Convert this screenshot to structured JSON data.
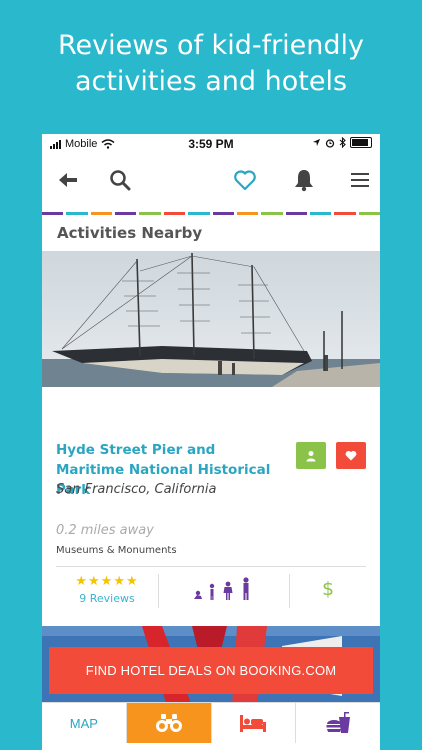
{
  "headline": {
    "line1": "Reviews of kid-friendly",
    "line2": "activities and hotels"
  },
  "status": {
    "carrier": "Mobile",
    "time": "3:59 PM"
  },
  "section": {
    "title": "Activities Nearby"
  },
  "activity": {
    "name": "Hyde Street Pier and Maritime National Historical Park",
    "location": "San Francisco, California",
    "distance": "0.2 miles away",
    "category": "Museums & Monuments",
    "rating_stars": "★★★★★",
    "reviews": "9 Reviews",
    "price": "$"
  },
  "booking": {
    "label": "FIND HOTEL DEALS ON BOOKING.COM"
  },
  "tabs": {
    "map": "MAP"
  },
  "colors": {
    "background": "#2ab8cc",
    "accent_teal": "#2aa6c2",
    "accent_red": "#f24b3a",
    "accent_green": "#8bc34a",
    "accent_orange": "#f7941d",
    "accent_purple": "#6a3aa0"
  }
}
